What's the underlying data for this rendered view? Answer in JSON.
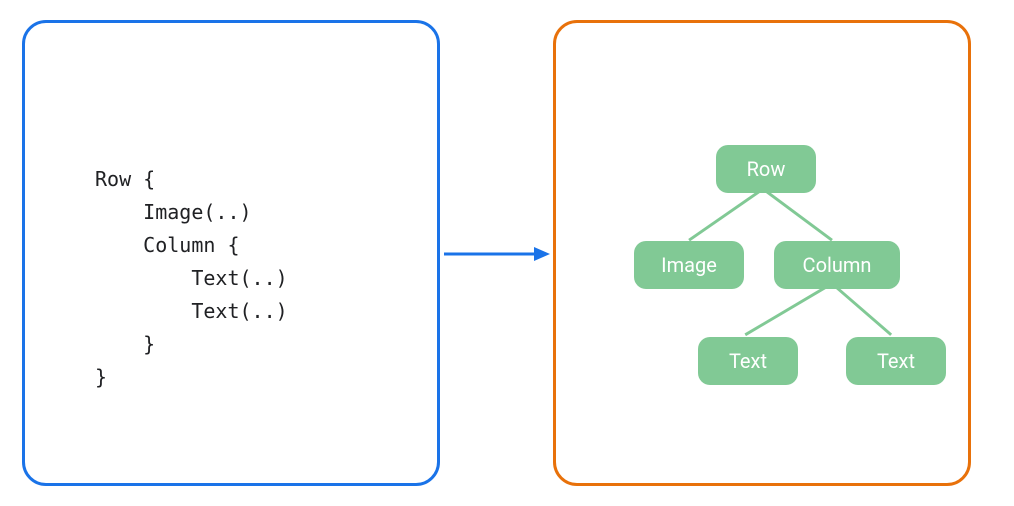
{
  "colors": {
    "left_border": "#1a73e8",
    "right_border": "#e8710a",
    "arrow": "#1a73e8",
    "node_bg": "#81c995",
    "node_text": "#ffffff",
    "edge": "#81c995"
  },
  "code": {
    "lines": [
      "Row {",
      "    Image(..)",
      "    Column {",
      "        Text(..)",
      "        Text(..)",
      "    }",
      "}"
    ],
    "text": "Row {\n    Image(..)\n    Column {\n        Text(..)\n        Text(..)\n    }\n}"
  },
  "tree": {
    "root": {
      "label": "Row"
    },
    "level2": [
      {
        "label": "Image"
      },
      {
        "label": "Column"
      }
    ],
    "level3": [
      {
        "label": "Text"
      },
      {
        "label": "Text"
      }
    ]
  }
}
